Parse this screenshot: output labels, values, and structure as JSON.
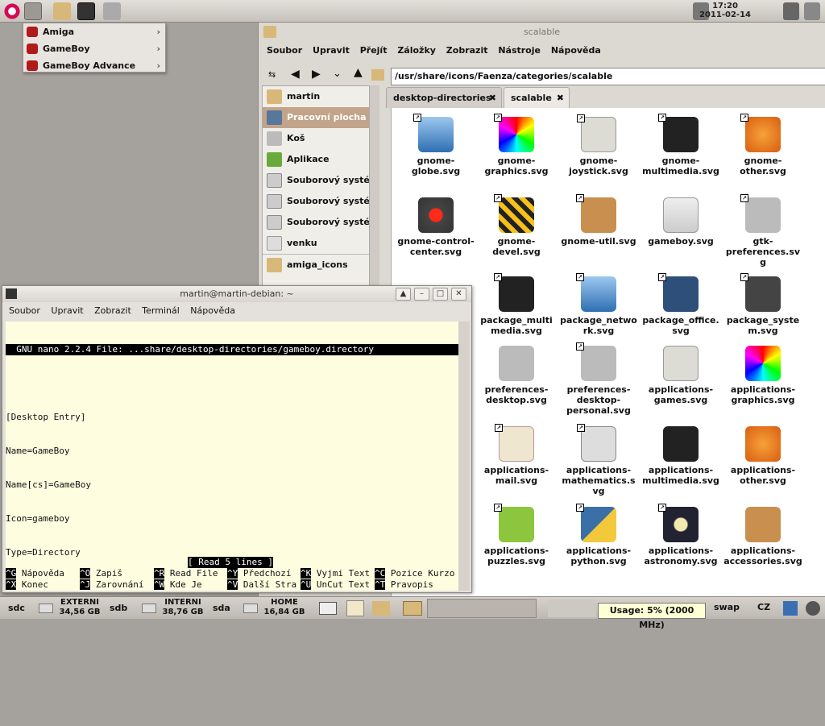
{
  "topbar": {
    "time": "17:20",
    "date": "2011-02-14"
  },
  "menu": {
    "items": [
      "Amiga",
      "GameBoy",
      "GameBoy Advance"
    ]
  },
  "fm": {
    "title": "scalable",
    "menubar": [
      "Soubor",
      "Upravit",
      "Přejít",
      "Záložky",
      "Zobrazit",
      "Nástroje",
      "Nápověda"
    ],
    "location": "/usr/share/icons/Faenza/categories/scalable",
    "sidebar": [
      "martin",
      "Pracovní plocha",
      "Koš",
      "Aplikace",
      "Souborový systém",
      "Souborový systém",
      "Souborový systém",
      "venku",
      "amiga_icons"
    ],
    "tabs": [
      "desktop-directories",
      "scalable"
    ],
    "icons": [
      "gnome-\nglobe.svg",
      "gnome-\ngraphics.svg",
      "gnome-\njoystick.svg",
      "gnome-\nmultimedia.svg",
      "gnome-\nother.svg",
      "gnome-control-\ncenter.svg",
      "gnome-\ndevel.svg",
      "gnome-util.svg",
      "gameboy.svg",
      "gtk-\npreferences.sv\ng",
      "",
      "package_multi\nmedia.svg",
      "package_netwo\nrk.svg",
      "package_office.\nsvg",
      "package_syste\nm.svg",
      "",
      "preferences-\ndesktop.svg",
      "preferences-\ndesktop-\npersonal.svg",
      "applications-\ngames.svg",
      "applications-\ngraphics.svg",
      "",
      "applications-\nmail.svg",
      "applications-\nmathematics.s\nvg",
      "applications-\nmultimedia.svg",
      "applications-\nother.svg",
      "",
      "applications-\npuzzles.svg",
      "applications-\npython.svg",
      "applications-\nastronomy.svg",
      "applications-\naccessories.svg"
    ]
  },
  "term": {
    "title": "martin@martin-debian: ~",
    "menubar": [
      "Soubor",
      "Upravit",
      "Zobrazit",
      "Terminál",
      "Nápověda"
    ],
    "header": "  GNU nano 2.2.4 File: ...share/desktop-directories/gameboy.directory",
    "lines": [
      "[Desktop Entry]",
      "Name=GameBoy",
      "Name[cs]=GameBoy",
      "Icon=gameboy",
      "Type=Directory"
    ],
    "status": "[ Read 5 lines ]",
    "keys": [
      [
        "^G",
        "Nápověda"
      ],
      [
        "^O",
        "Zapiš"
      ],
      [
        "^R",
        "Read File"
      ],
      [
        "^Y",
        "Předchozí"
      ],
      [
        "^K",
        "Vyjmi Text"
      ],
      [
        "^C",
        "Pozice Kurzo"
      ],
      [
        "^X",
        "Konec"
      ],
      [
        "^J",
        "Zarovnání"
      ],
      [
        "^W",
        "Kde Je"
      ],
      [
        "^V",
        "Další Stra"
      ],
      [
        "^U",
        "UnCut Text"
      ],
      [
        "^T",
        "Pravopis"
      ]
    ]
  },
  "bottom": {
    "devices": [
      {
        "dev": "sdc",
        "name": "EXTERNI",
        "size": "34,56 GB"
      },
      {
        "dev": "sdb",
        "name": "INTERNI",
        "size": "38,76 GB"
      },
      {
        "dev": "sda",
        "name": "HOME",
        "size": "16,84 GB"
      }
    ],
    "swap": "swap",
    "layout": "CZ",
    "tooltip": "Usage: 5% (2000 MHz)"
  },
  "colors": {
    "accent": "#c2a48a",
    "nano_bg": "#fffde0"
  }
}
